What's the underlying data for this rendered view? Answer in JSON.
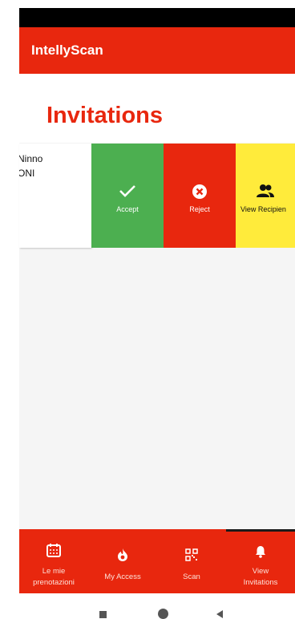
{
  "app": {
    "title": "IntellyScan"
  },
  "page": {
    "heading": "Invitations"
  },
  "card": {
    "line1": "Ninno",
    "line2": "ONI"
  },
  "actions": {
    "accept": "Accept",
    "reject": "Reject",
    "view_recipients": "View Recipien"
  },
  "bottom_nav": {
    "items": [
      {
        "line1": "Le mie",
        "line2": "prenotazioni",
        "icon": "calendar-icon"
      },
      {
        "line1": "My Access",
        "icon": "flame-icon"
      },
      {
        "line1": "Scan",
        "icon": "qr-code-icon"
      },
      {
        "line1": "View",
        "line2": "Invitations",
        "icon": "bell-icon",
        "active": true
      }
    ]
  },
  "colors": {
    "brand": "#e8270e",
    "accept": "#4caf50",
    "view": "#ffeb3b"
  }
}
